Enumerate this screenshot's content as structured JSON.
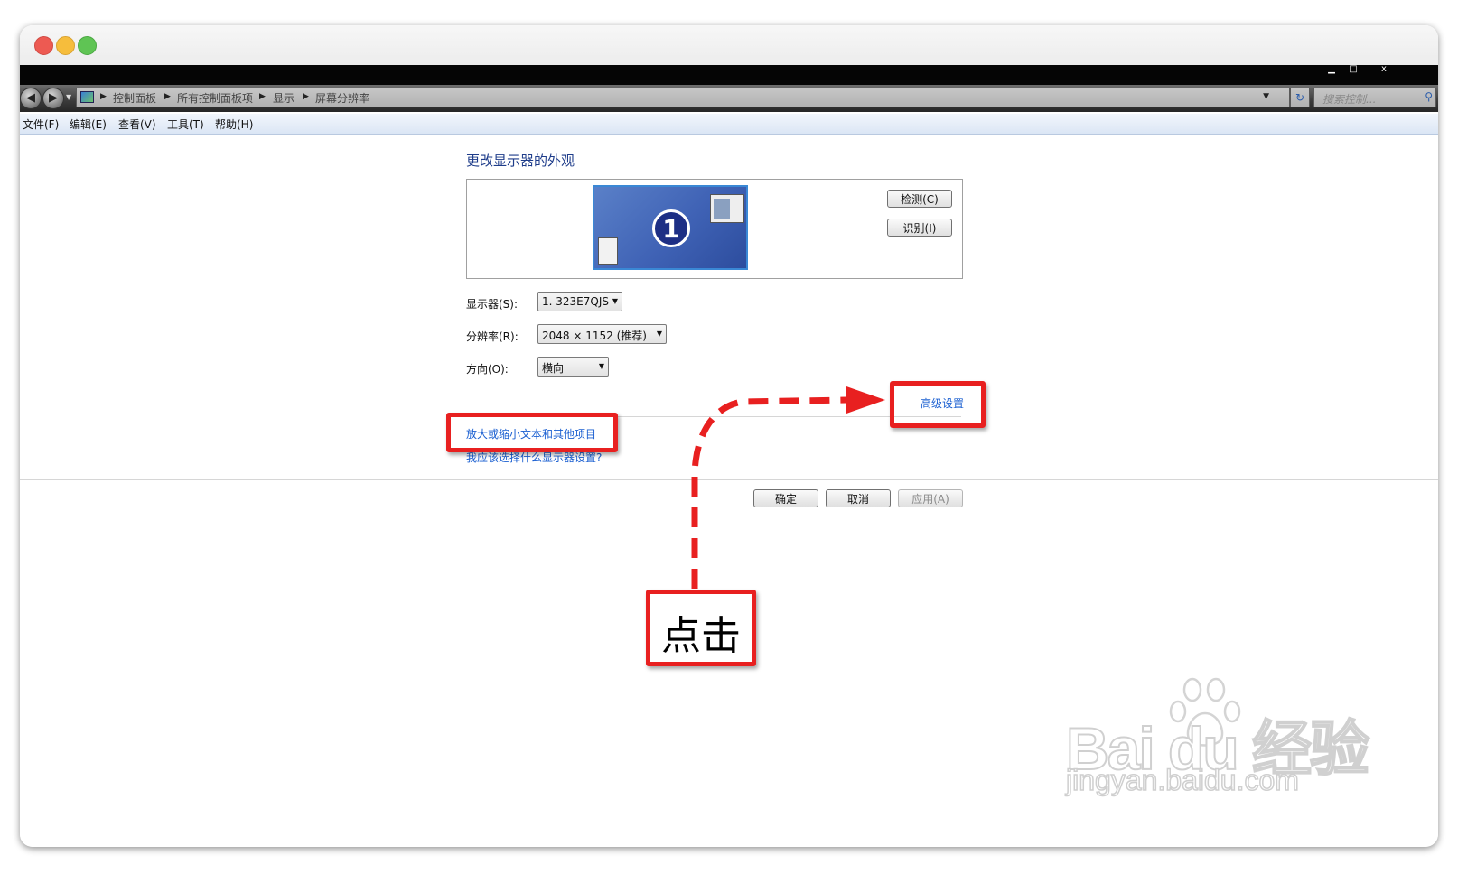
{
  "window": {
    "controls": {
      "minimize": "▁",
      "maximize": "□",
      "close": "x"
    }
  },
  "navigation": {
    "back_icon": "back-arrow-icon",
    "forward_icon": "forward-arrow-icon",
    "breadcrumb": [
      "控制面板",
      "所有控制面板项",
      "显示",
      "屏幕分辨率"
    ],
    "search_placeholder": "搜索控制..."
  },
  "menu": {
    "items": [
      "文件(F)",
      "编辑(E)",
      "查看(V)",
      "工具(T)",
      "帮助(H)"
    ]
  },
  "main": {
    "title": "更改显示器的外观",
    "monitor_number": "1",
    "detect_button": "检测(C)",
    "identify_button": "识别(I)",
    "display_label": "显示器(S):",
    "display_value": "1. 323E7QJS",
    "resolution_label": "分辨率(R):",
    "resolution_value": "2048 × 1152 (推荐)",
    "orientation_label": "方向(O):",
    "orientation_value": "横向",
    "advanced_link": "高级设置",
    "zoom_link": "放大或缩小文本和其他项目",
    "help_link": "我应该选择什么显示器设置?",
    "ok_button": "确定",
    "cancel_button": "取消",
    "apply_button": "应用(A)"
  },
  "annotation": {
    "click_text": "点击",
    "color": "#e82020"
  },
  "watermark": {
    "brand": "Bai du 经验",
    "url": "jingyan.baidu.com"
  }
}
